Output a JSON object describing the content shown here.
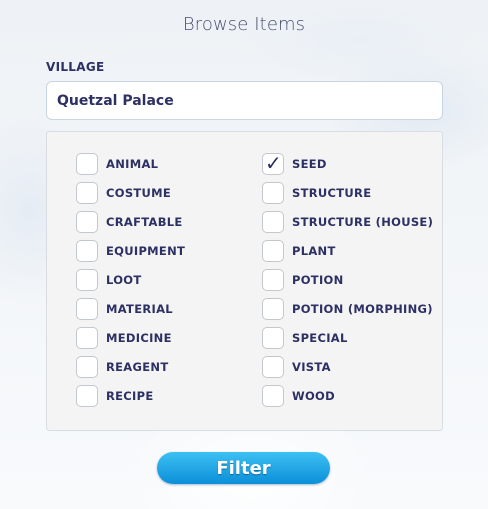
{
  "page": {
    "title": "Browse Items"
  },
  "village": {
    "label": "VILLAGE",
    "value": "Quetzal Palace"
  },
  "categories": {
    "left": [
      {
        "label": "ANIMAL",
        "checked": false
      },
      {
        "label": "COSTUME",
        "checked": false
      },
      {
        "label": "CRAFTABLE",
        "checked": false
      },
      {
        "label": "EQUIPMENT",
        "checked": false
      },
      {
        "label": "LOOT",
        "checked": false
      },
      {
        "label": "MATERIAL",
        "checked": false
      },
      {
        "label": "MEDICINE",
        "checked": false
      },
      {
        "label": "REAGENT",
        "checked": false
      },
      {
        "label": "RECIPE",
        "checked": false
      }
    ],
    "right": [
      {
        "label": "SEED",
        "checked": true
      },
      {
        "label": "STRUCTURE",
        "checked": false
      },
      {
        "label": "STRUCTURE (HOUSE)",
        "checked": false
      },
      {
        "label": "PLANT",
        "checked": false
      },
      {
        "label": "POTION",
        "checked": false
      },
      {
        "label": "POTION (MORPHING)",
        "checked": false
      },
      {
        "label": "SPECIAL",
        "checked": false
      },
      {
        "label": "VISTA",
        "checked": false
      },
      {
        "label": "WOOD",
        "checked": false
      }
    ]
  },
  "actions": {
    "filter_label": "Filter"
  },
  "colors": {
    "text": "#2d3062",
    "button_top": "#3dc0f2",
    "button_bottom": "#0b8fd8",
    "check_icon": "checkmark-icon"
  }
}
